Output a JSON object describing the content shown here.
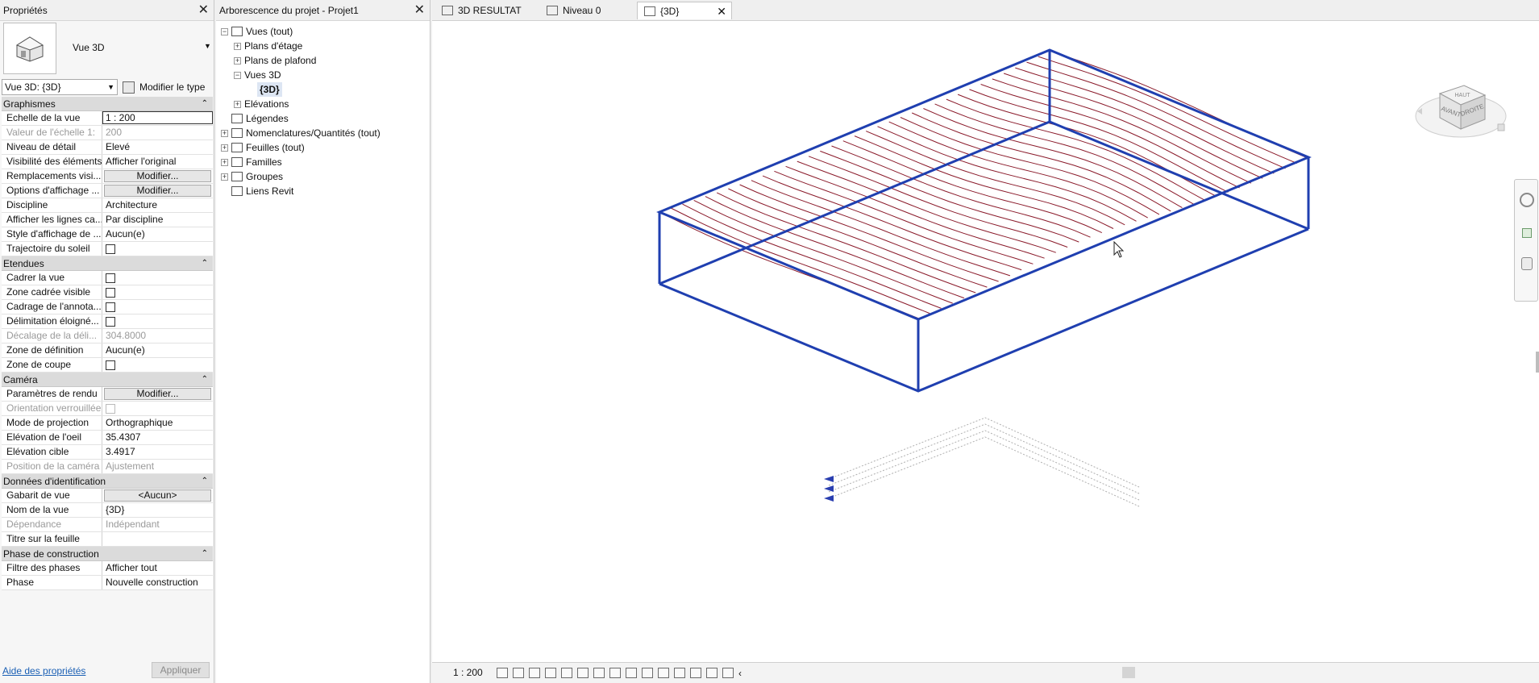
{
  "properties": {
    "title": "Propriétés",
    "type_name": "Vue 3D",
    "view_selector": "Vue 3D: {3D}",
    "edit_type": "Modifier le type",
    "sections": [
      {
        "header": "Graphismes",
        "rows": [
          {
            "label": "Echelle de la vue",
            "value": "1 : 200",
            "kind": "input"
          },
          {
            "label": "Valeur de l'échelle    1:",
            "value": "200",
            "kind": "dim"
          },
          {
            "label": "Niveau de détail",
            "value": "Elevé",
            "kind": "text"
          },
          {
            "label": "Visibilité des éléments",
            "value": "Afficher l'original",
            "kind": "text"
          },
          {
            "label": "Remplacements visi...",
            "value": "Modifier...",
            "kind": "button"
          },
          {
            "label": "Options d'affichage ...",
            "value": "Modifier...",
            "kind": "button"
          },
          {
            "label": "Discipline",
            "value": "Architecture",
            "kind": "text"
          },
          {
            "label": "Afficher les lignes ca...",
            "value": "Par discipline",
            "kind": "text"
          },
          {
            "label": "Style d'affichage de ...",
            "value": "Aucun(e)",
            "kind": "text"
          },
          {
            "label": "Trajectoire du soleil",
            "value": "",
            "kind": "check"
          }
        ]
      },
      {
        "header": "Etendues",
        "rows": [
          {
            "label": "Cadrer la vue",
            "value": "",
            "kind": "check"
          },
          {
            "label": "Zone cadrée visible",
            "value": "",
            "kind": "check"
          },
          {
            "label": "Cadrage de l'annota...",
            "value": "",
            "kind": "check"
          },
          {
            "label": "Délimitation éloigné...",
            "value": "",
            "kind": "check"
          },
          {
            "label": "Décalage de la déli...",
            "value": "304.8000",
            "kind": "dim"
          },
          {
            "label": "Zone de définition",
            "value": "Aucun(e)",
            "kind": "text"
          },
          {
            "label": "Zone de coupe",
            "value": "",
            "kind": "check"
          }
        ]
      },
      {
        "header": "Caméra",
        "rows": [
          {
            "label": "Paramètres de rendu",
            "value": "Modifier...",
            "kind": "button"
          },
          {
            "label": "Orientation verrouillée",
            "value": "",
            "kind": "dimcheck"
          },
          {
            "label": "Mode de projection",
            "value": "Orthographique",
            "kind": "text"
          },
          {
            "label": "Elévation de l'oeil",
            "value": "35.4307",
            "kind": "text"
          },
          {
            "label": "Elévation cible",
            "value": "3.4917",
            "kind": "text"
          },
          {
            "label": "Position de la caméra",
            "value": "Ajustement",
            "kind": "dim"
          }
        ]
      },
      {
        "header": "Données d'identification",
        "rows": [
          {
            "label": "Gabarit de vue",
            "value": "<Aucun>",
            "kind": "button"
          },
          {
            "label": "Nom de la vue",
            "value": "{3D}",
            "kind": "text"
          },
          {
            "label": "Dépendance",
            "value": "Indépendant",
            "kind": "dim"
          },
          {
            "label": "Titre sur la feuille",
            "value": "",
            "kind": "text"
          }
        ]
      },
      {
        "header": "Phase de construction",
        "rows": [
          {
            "label": "Filtre des phases",
            "value": "Afficher tout",
            "kind": "text"
          },
          {
            "label": "Phase",
            "value": "Nouvelle construction",
            "kind": "text"
          }
        ]
      }
    ],
    "help_link": "Aide des propriétés",
    "apply_button": "Appliquer"
  },
  "browser": {
    "title": "Arborescence du projet - Projet1",
    "nodes": [
      {
        "label": "Vues (tout)",
        "toggle": "−",
        "icon": true
      },
      {
        "label": "Plans d'étage",
        "toggle": "+",
        "icon": false
      },
      {
        "label": "Plans de plafond",
        "toggle": "+",
        "icon": false
      },
      {
        "label": "Vues 3D",
        "toggle": "−",
        "icon": false
      },
      {
        "label": "{3D}",
        "toggle": "",
        "icon": false
      },
      {
        "label": "Elévations",
        "toggle": "+",
        "icon": false
      },
      {
        "label": "Légendes",
        "toggle": "",
        "icon": true
      },
      {
        "label": "Nomenclatures/Quantités (tout)",
        "toggle": "+",
        "icon": true
      },
      {
        "label": "Feuilles (tout)",
        "toggle": "+",
        "icon": true
      },
      {
        "label": "Familles",
        "toggle": "+",
        "icon": true
      },
      {
        "label": "Groupes",
        "toggle": "+",
        "icon": true
      },
      {
        "label": "Liens Revit",
        "toggle": "",
        "icon": true
      }
    ]
  },
  "tabs": [
    {
      "label": "3D RESULTAT",
      "active": false
    },
    {
      "label": "Niveau 0",
      "active": false
    },
    {
      "label": "{3D}",
      "active": true
    }
  ],
  "viewcube": {
    "top": "HAUT",
    "front": "AVANT",
    "right": "DROITE"
  },
  "status": {
    "scale": "1 : 200"
  },
  "colors": {
    "box_edges": "#1f3fb0",
    "contours": "#8a1a2a"
  }
}
